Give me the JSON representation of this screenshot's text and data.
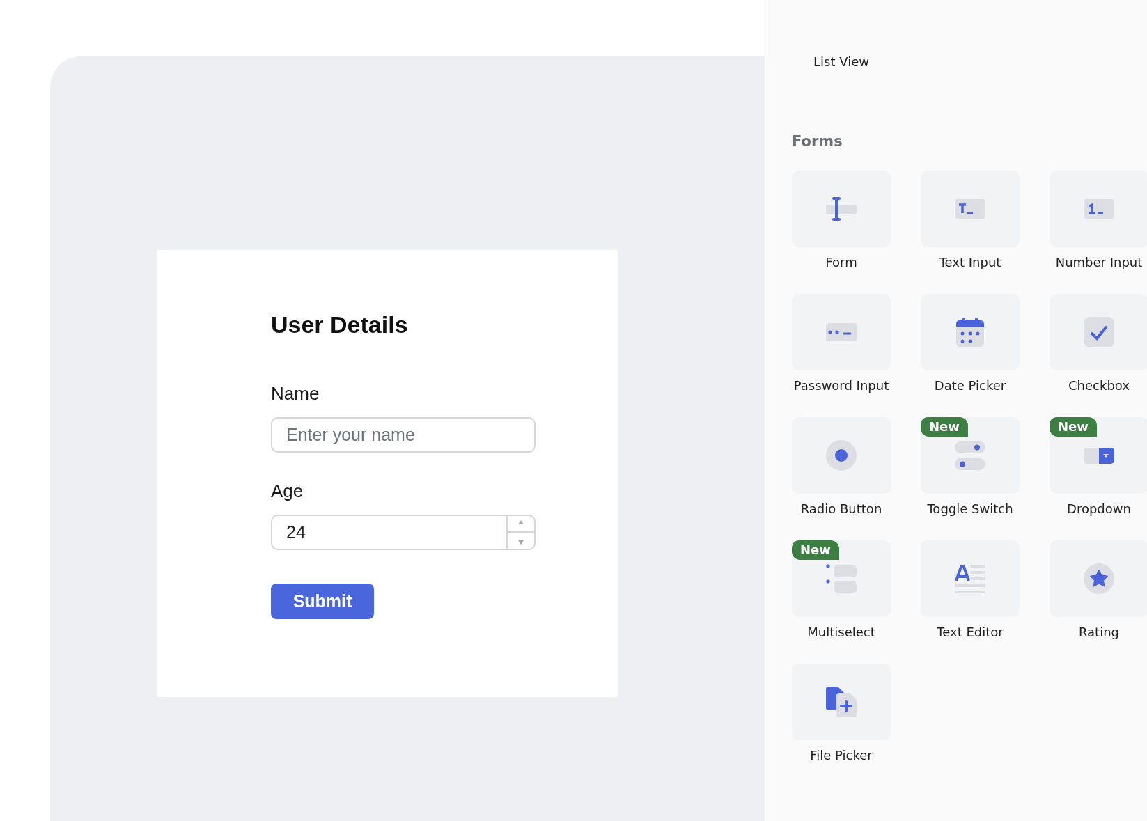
{
  "form_card": {
    "title": "User Details",
    "fields": [
      {
        "kind": "text",
        "label": "Name",
        "placeholder": "Enter your name"
      },
      {
        "kind": "number",
        "label": "Age",
        "value": "24"
      }
    ],
    "submit_button": "Submit"
  },
  "component_panel": {
    "previous_section": {
      "items": [
        "List View"
      ]
    },
    "section_title": "Forms",
    "items": [
      {
        "name": "Form",
        "kind": "form"
      },
      {
        "name": "Text Input",
        "kind": "text-input"
      },
      {
        "name": "Number Input",
        "kind": "number-input"
      },
      {
        "name": "Password Input",
        "kind": "password"
      },
      {
        "name": "Date Picker",
        "kind": "date"
      },
      {
        "name": "Checkbox",
        "kind": "checkbox"
      },
      {
        "name": "Radio Button",
        "kind": "radio"
      },
      {
        "name": "Toggle Switch",
        "kind": "toggle",
        "badge": "New"
      },
      {
        "name": "Dropdown",
        "kind": "dropdown",
        "badge": "New"
      },
      {
        "name": "Multiselect",
        "kind": "multiselect",
        "badge": "New"
      },
      {
        "name": "Text Editor",
        "kind": "editor"
      },
      {
        "name": "Rating",
        "kind": "rating"
      },
      {
        "name": "File Picker",
        "kind": "file"
      }
    ]
  }
}
